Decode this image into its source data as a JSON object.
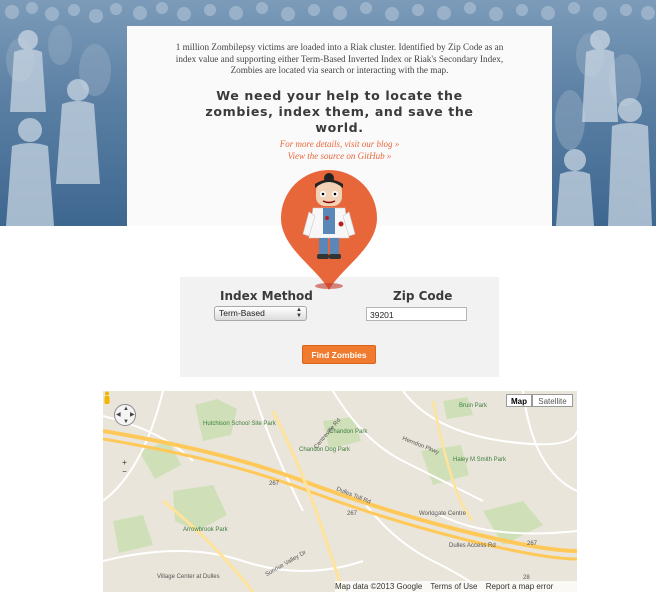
{
  "intro": {
    "description": "1 million Zombilepsy victims are loaded into a Riak cluster. Identified by Zip Code as an index value and supporting either Term-Based Inverted Index or Riak's Secondary Index, Zombies are located via search or interacting with the map.",
    "tagline": "We need your help to locate the zombies, index them, and save the world.",
    "blog_link": "For more details, visit our blog »",
    "source_link": "View the source on GitHub »"
  },
  "form": {
    "index_label": "Index Method",
    "index_selected": "Term-Based",
    "zip_label": "Zip Code",
    "zip_value": "39201",
    "find_button": "Find Zombies"
  },
  "map": {
    "type_map": "Map",
    "type_satellite": "Satellite",
    "zoom_in": "+",
    "zoom_out": "−",
    "attribution": {
      "data": "Map data ©2013 Google",
      "terms": "Terms of Use",
      "report": "Report a map error"
    },
    "places": {
      "chandon_park": "Chandon Park",
      "chandon_dog_park": "Chandon Dog Park",
      "hutchison": "Hutchison School Site Park",
      "bruin_park": "Bruin Park",
      "haley_smith": "Haley M Smith Park",
      "worldgate": "Worldgate Centre",
      "arrowbrook": "Arrowbrook Park",
      "village_center": "Village Center at Dulles",
      "centreville_rd": "Centreville Rd",
      "dulles_toll": "Dulles Toll Rd",
      "dulles_access": "Dulles Access Rd",
      "herndon_pkwy": "Herndon Pkwy",
      "sunrise_valley": "Sunrise Valley Dr"
    },
    "route_labels": [
      "267",
      "267",
      "267",
      "28"
    ]
  },
  "colors": {
    "accent": "#f07a2d",
    "link": "#e8673a",
    "pin": "#e8673a",
    "hero": "#5a7fa3"
  }
}
